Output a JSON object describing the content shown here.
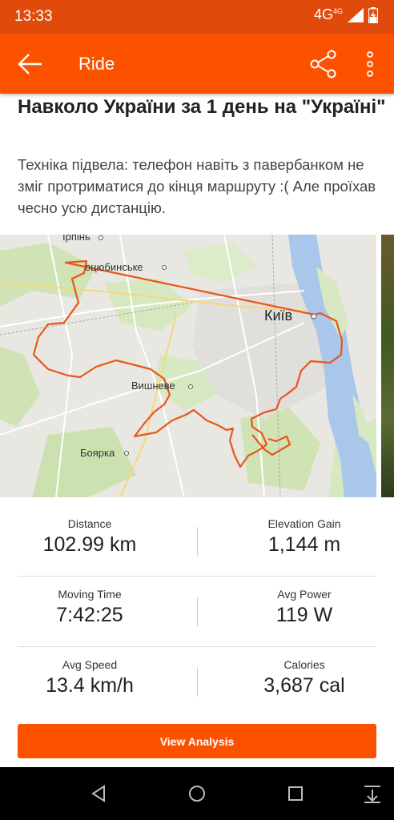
{
  "status_bar": {
    "time": "13:33",
    "network": "4G",
    "network_small": "4G"
  },
  "app_bar": {
    "title": "Ride",
    "icons": [
      "back-arrow-icon",
      "share-icon",
      "more-vert-icon"
    ]
  },
  "activity": {
    "title": "Навколо України за 1 день на \"Україні\"",
    "description": "Техніка підвела: телефон  навіть з павербанком не зміг протриматися до кінця маршруту :( Але проїхав чесно усю дистанцію."
  },
  "map": {
    "labels": {
      "irpin": "Ірпінь",
      "kotsiubynske": "оцюбинське",
      "kyiv": "Київ",
      "vyshneve": "Вишневе",
      "boiarka": "Боярка"
    },
    "route_color": "#e8561a"
  },
  "stats": [
    {
      "label": "Distance",
      "value": "102.99 km"
    },
    {
      "label": "Elevation Gain",
      "value": "1,144 m"
    },
    {
      "label": "Moving Time",
      "value": "7:42:25"
    },
    {
      "label": "Avg Power",
      "value": "119 W"
    },
    {
      "label": "Avg Speed",
      "value": "13.4 km/h"
    },
    {
      "label": "Calories",
      "value": "3,687 cal"
    }
  ],
  "actions": {
    "view_analysis": "View Analysis"
  },
  "nav_bar": {
    "icons": [
      "back-triangle-icon",
      "home-circle-icon",
      "recents-square-icon",
      "notification-pull-icon"
    ]
  },
  "colors": {
    "accent": "#fc5200",
    "status_bar": "#e04a0b"
  }
}
